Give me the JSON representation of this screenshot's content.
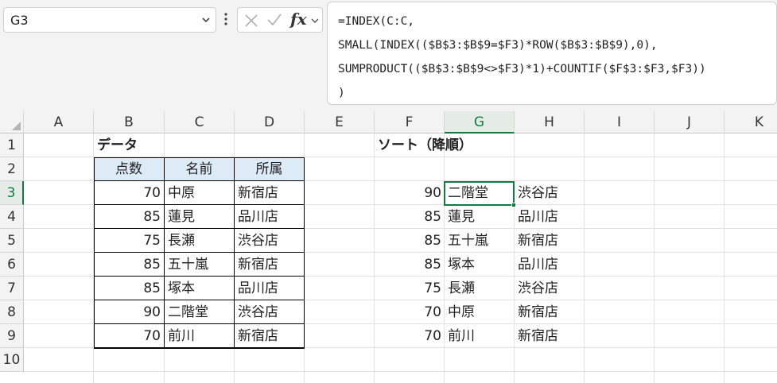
{
  "name_box": {
    "value": "G3"
  },
  "formula_bar": {
    "lines": [
      "=INDEX(C:C,",
      "SMALL(INDEX(($B$3:$B$9=$F3)*ROW($B$3:$B$9),0),",
      "SUMPRODUCT(($B$3:$B$9<>$F3)*1)+COUNTIF($F$3:$F3,$F3))",
      ")"
    ],
    "fx_label": "fx"
  },
  "column_headers": [
    "A",
    "B",
    "C",
    "D",
    "E",
    "F",
    "G",
    "H",
    "I",
    "J",
    "K"
  ],
  "row_headers": [
    "1",
    "2",
    "3",
    "4",
    "5",
    "6",
    "7",
    "8",
    "9",
    "10"
  ],
  "selected": {
    "column": "G",
    "row": "3"
  },
  "data_table": {
    "title": "データ",
    "headers": [
      "点数",
      "名前",
      "所属"
    ],
    "rows": [
      [
        "70",
        "中原",
        "新宿店"
      ],
      [
        "85",
        "蓮見",
        "品川店"
      ],
      [
        "75",
        "長瀬",
        "渋谷店"
      ],
      [
        "85",
        "五十嵐",
        "新宿店"
      ],
      [
        "85",
        "塚本",
        "品川店"
      ],
      [
        "90",
        "二階堂",
        "渋谷店"
      ],
      [
        "70",
        "前川",
        "新宿店"
      ]
    ]
  },
  "sorted_table": {
    "title": "ソート（降順）",
    "rows": [
      [
        "90",
        "二階堂",
        "渋谷店"
      ],
      [
        "85",
        "蓮見",
        "品川店"
      ],
      [
        "85",
        "五十嵐",
        "新宿店"
      ],
      [
        "85",
        "塚本",
        "品川店"
      ],
      [
        "75",
        "長瀬",
        "渋谷店"
      ],
      [
        "70",
        "中原",
        "新宿店"
      ],
      [
        "70",
        "前川",
        "新宿店"
      ]
    ]
  },
  "colors": {
    "accent": "#107c41",
    "header_fill": "#ddebf7",
    "chrome": "#f3f3f3"
  }
}
